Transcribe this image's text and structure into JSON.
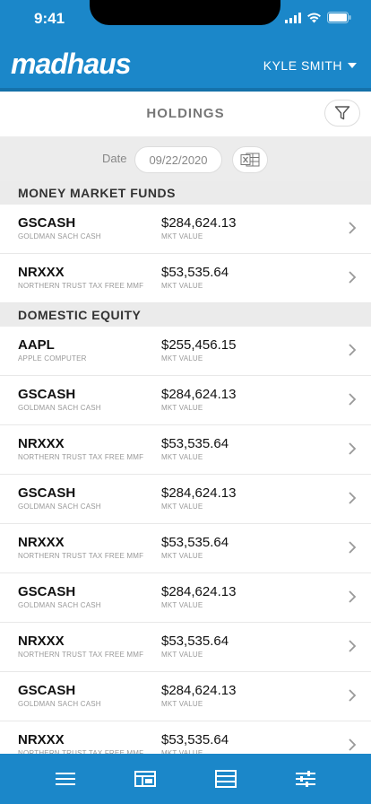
{
  "status": {
    "time": "9:41"
  },
  "header": {
    "brand": "madhaus",
    "user": "KYLE SMITH"
  },
  "page": {
    "title": "HOLDINGS"
  },
  "date": {
    "label": "Date",
    "value": "09/22/2020"
  },
  "sections": [
    {
      "title": "MONEY MARKET FUNDS",
      "rows": [
        {
          "symbol": "GSCASH",
          "name": "GOLDMAN SACH CASH",
          "value": "$284,624.13",
          "value_label": "MKT VALUE"
        },
        {
          "symbol": "NRXXX",
          "name": "NORTHERN TRUST TAX FREE MMF",
          "value": "$53,535.64",
          "value_label": "MKT VALUE"
        }
      ]
    },
    {
      "title": "DOMESTIC EQUITY",
      "rows": [
        {
          "symbol": "AAPL",
          "name": "APPLE COMPUTER",
          "value": "$255,456.15",
          "value_label": "MKT VALUE"
        },
        {
          "symbol": "GSCASH",
          "name": "GOLDMAN SACH CASH",
          "value": "$284,624.13",
          "value_label": "MKT VALUE"
        },
        {
          "symbol": "NRXXX",
          "name": "NORTHERN TRUST TAX FREE MMF",
          "value": "$53,535.64",
          "value_label": "MKT VALUE"
        },
        {
          "symbol": "GSCASH",
          "name": "GOLDMAN SACH CASH",
          "value": "$284,624.13",
          "value_label": "MKT VALUE"
        },
        {
          "symbol": "NRXXX",
          "name": "NORTHERN TRUST TAX FREE MMF",
          "value": "$53,535.64",
          "value_label": "MKT VALUE"
        },
        {
          "symbol": "GSCASH",
          "name": "GOLDMAN SACH CASH",
          "value": "$284,624.13",
          "value_label": "MKT VALUE"
        },
        {
          "symbol": "NRXXX",
          "name": "NORTHERN TRUST TAX FREE MMF",
          "value": "$53,535.64",
          "value_label": "MKT VALUE"
        },
        {
          "symbol": "GSCASH",
          "name": "GOLDMAN SACH CASH",
          "value": "$284,624.13",
          "value_label": "MKT VALUE"
        },
        {
          "symbol": "NRXXX",
          "name": "NORTHERN TRUST TAX FREE MMF",
          "value": "$53,535.64",
          "value_label": "MKT VALUE"
        }
      ]
    }
  ],
  "nav": {
    "items": [
      {
        "icon": "menu-icon"
      },
      {
        "icon": "dashboard-icon"
      },
      {
        "icon": "list-icon"
      },
      {
        "icon": "sliders-icon"
      }
    ]
  },
  "colors": {
    "brand": "#1b87c9",
    "section_bg": "#ebebeb"
  }
}
